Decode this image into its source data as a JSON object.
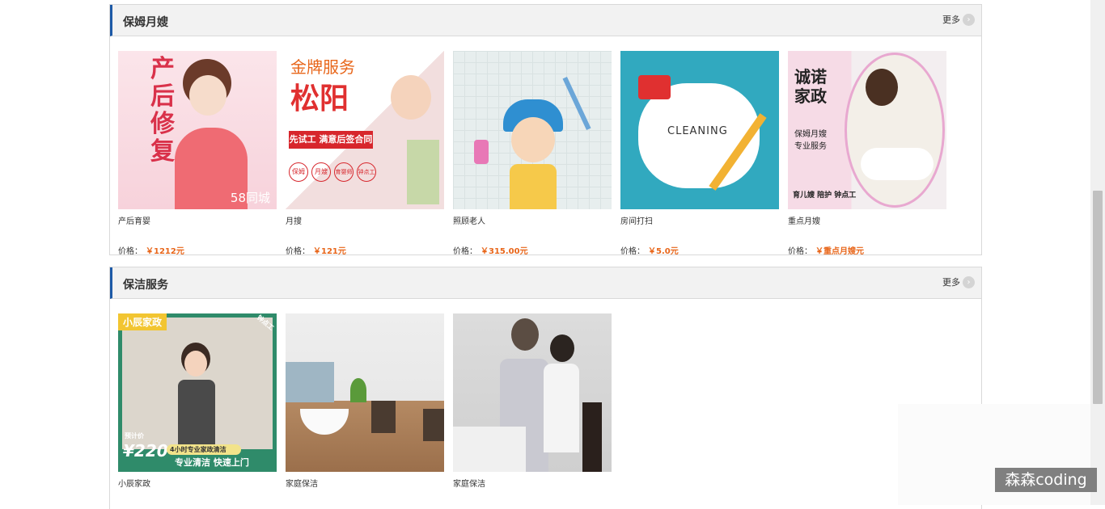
{
  "sections": [
    {
      "title": "保姆月嫂",
      "more": "更多",
      "price_label": "价格：",
      "items": [
        {
          "name": "产后育婴",
          "price": "￥1212元",
          "art_text": "产后修复",
          "art_sub": "58同城"
        },
        {
          "name": "月搜",
          "price": "￥121元",
          "art_text": "松阳",
          "art_top": "金牌服务",
          "art_band": "先试工 满意后签合同",
          "art_tags": [
            "保姆",
            "月嫂",
            "育婴师",
            "钟点工"
          ]
        },
        {
          "name": "照顾老人",
          "price": "￥315.00元"
        },
        {
          "name": "房间打扫",
          "price": "￥5.0元",
          "art_text": "CLEANING"
        },
        {
          "name": "重点月嫂",
          "price": "￥重点月嫂元",
          "art_text": "诚诺家政",
          "art_sub": "保姆月嫂 专业服务",
          "art_foot": "育儿嫂 陪护 钟点工"
        }
      ]
    },
    {
      "title": "保洁服务",
      "more": "更多",
      "items": [
        {
          "name": "小辰家政",
          "art_text": "小辰家政",
          "art_corner": "钟点工",
          "art_price_label": "预计价",
          "art_price": "¥220",
          "art_line1": "4小时专业家政清洁",
          "art_line2": "专业清洁  快速上门"
        },
        {
          "name": "家庭保洁"
        },
        {
          "name": "家庭保洁"
        }
      ]
    }
  ],
  "watermark": "森森coding",
  "colors": {
    "accent": "#1d5aa7",
    "price": "#e8661a"
  }
}
